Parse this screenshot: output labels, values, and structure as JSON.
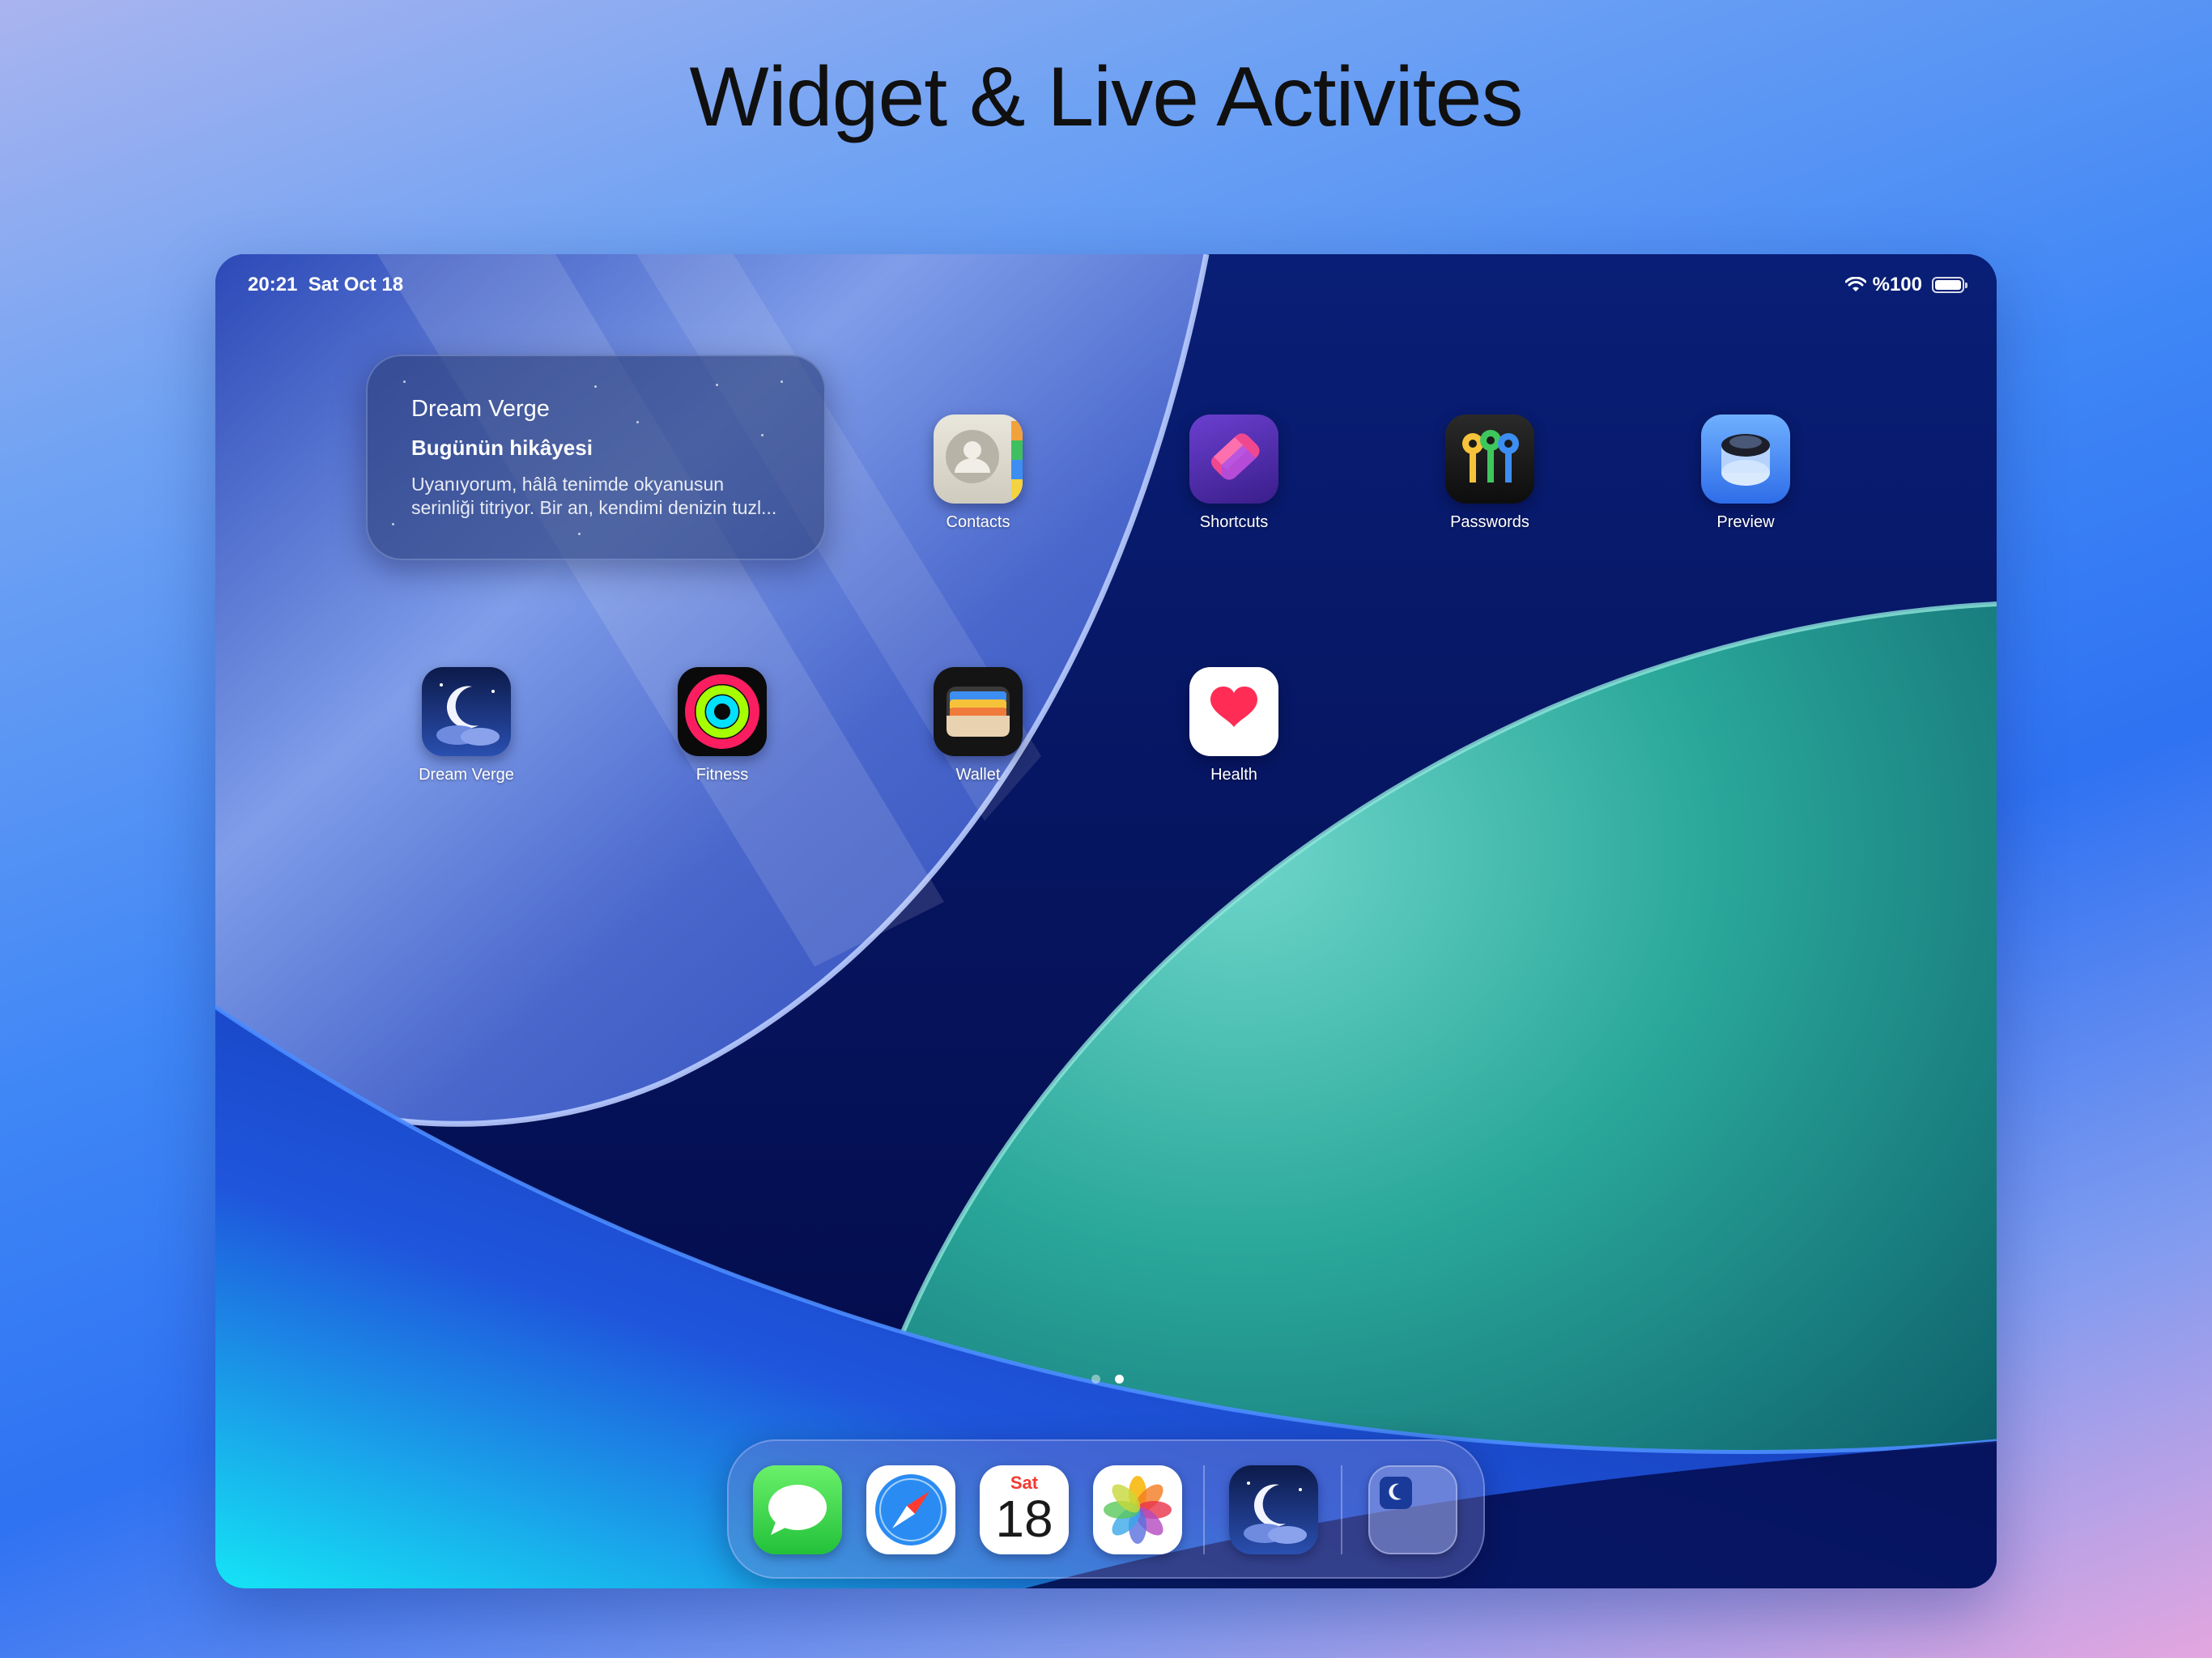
{
  "headline": "Widget & Live Activites",
  "status_bar": {
    "time": "20:21",
    "date": "Sat Oct 18",
    "battery_text": "%100"
  },
  "widget": {
    "title": "Dream Verge",
    "subtitle": "Bugünün hikâyesi",
    "body_line1": "Uyanıyorum, hâlâ tenimde okyanusun",
    "body_line2": "serinliği titriyor. Bir an, kendimi denizin tuzl..."
  },
  "apps": [
    {
      "name": "Contacts",
      "icon": "contacts-icon"
    },
    {
      "name": "Shortcuts",
      "icon": "shortcuts-icon"
    },
    {
      "name": "Passwords",
      "icon": "passwords-icon"
    },
    {
      "name": "Preview",
      "icon": "preview-icon"
    },
    {
      "name": "Dream Verge",
      "icon": "dream-verge-icon"
    },
    {
      "name": "Fitness",
      "icon": "fitness-icon"
    },
    {
      "name": "Wallet",
      "icon": "wallet-icon"
    },
    {
      "name": "Health",
      "icon": "health-icon"
    }
  ],
  "page_indicator": {
    "pages": 2,
    "current": 2
  },
  "dock": {
    "apps": [
      "messages-icon",
      "safari-icon",
      "calendar-icon",
      "photos-icon",
      "dream-verge-icon",
      "app-library-icon"
    ],
    "calendar_day": "Sat",
    "calendar_date": "18"
  },
  "colors": {
    "wallpaper_dark": "#071a68",
    "wallpaper_teal": "#2aa89a",
    "wallpaper_light_blue": "#5f7fe0"
  }
}
